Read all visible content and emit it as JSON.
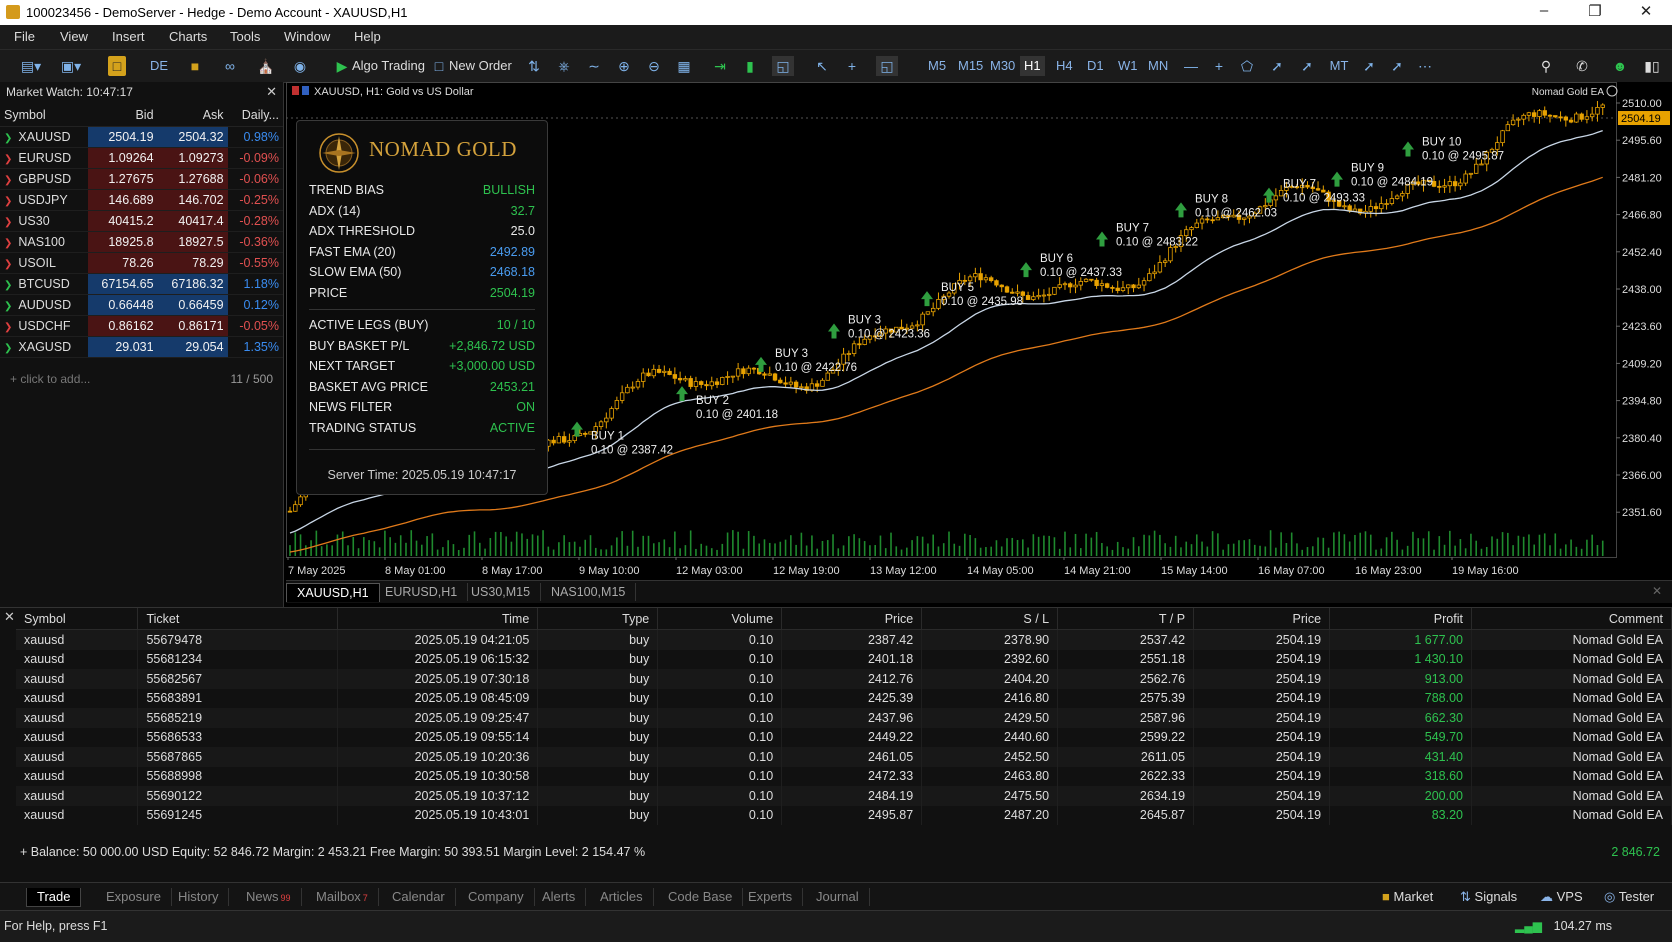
{
  "window": {
    "title": "100023456 - DemoServer - Hedge - Demo Account - XAUUSD,H1"
  },
  "menu": [
    "File",
    "View",
    "Insert",
    "Charts",
    "Tools",
    "Window",
    "Help"
  ],
  "toolbar": {
    "de": "DE",
    "algo_trading": "Algo Trading",
    "new_order": "New Order",
    "mt": "MT",
    "timeframes": [
      "M5",
      "M15",
      "M30",
      "H1",
      "H4",
      "D1",
      "W1",
      "MN"
    ],
    "active_timeframe": "H1",
    "notif_count": "1"
  },
  "market_watch": {
    "title": "Market Watch: 10:47:17",
    "columns": [
      "Symbol",
      "Bid",
      "Ask",
      "Daily..."
    ],
    "rows": [
      {
        "symbol": "XAUUSD",
        "bid": "2504.19",
        "ask": "2504.32",
        "daily": "0.98%",
        "dir": "up"
      },
      {
        "symbol": "EURUSD",
        "bid": "1.09264",
        "ask": "1.09273",
        "daily": "-0.09%",
        "dir": "dn"
      },
      {
        "symbol": "GBPUSD",
        "bid": "1.27675",
        "ask": "1.27688",
        "daily": "-0.06%",
        "dir": "dn"
      },
      {
        "symbol": "USDJPY",
        "bid": "146.689",
        "ask": "146.702",
        "daily": "-0.25%",
        "dir": "dn"
      },
      {
        "symbol": "US30",
        "bid": "40415.2",
        "ask": "40417.4",
        "daily": "-0.28%",
        "dir": "dn"
      },
      {
        "symbol": "NAS100",
        "bid": "18925.8",
        "ask": "18927.5",
        "daily": "-0.36%",
        "dir": "dn"
      },
      {
        "symbol": "USOIL",
        "bid": "78.26",
        "ask": "78.29",
        "daily": "-0.55%",
        "dir": "dn"
      },
      {
        "symbol": "BTCUSD",
        "bid": "67154.65",
        "ask": "67186.32",
        "daily": "1.18%",
        "dir": "up"
      },
      {
        "symbol": "AUDUSD",
        "bid": "0.66448",
        "ask": "0.66459",
        "daily": "0.12%",
        "dir": "up"
      },
      {
        "symbol": "USDCHF",
        "bid": "0.86162",
        "ask": "0.86171",
        "daily": "-0.05%",
        "dir": "dn"
      },
      {
        "symbol": "XAGUSD",
        "bid": "29.031",
        "ask": "29.054",
        "daily": "1.35%",
        "dir": "up"
      }
    ],
    "add_text": "+ click to add...",
    "count": "11 / 500"
  },
  "chart": {
    "header": "XAUUSD, H1: Gold vs US Dollar",
    "ea_label": "Nomad Gold EA",
    "current_price": "2504.19",
    "y_labels": [
      "2510.00",
      "2495.60",
      "2481.20",
      "2466.80",
      "2452.40",
      "2438.00",
      "2423.60",
      "2409.20",
      "2394.80",
      "2380.40",
      "2366.00",
      "2351.60"
    ],
    "x_labels": [
      "7 May 2025",
      "8 May 01:00",
      "8 May 17:00",
      "9 May 10:00",
      "12 May 03:00",
      "12 May 19:00",
      "13 May 12:00",
      "14 May 05:00",
      "14 May 21:00",
      "15 May 14:00",
      "16 May 07:00",
      "16 May 23:00",
      "19 May 16:00"
    ],
    "buy_markers": [
      {
        "label": "BUY 1",
        "detail": "0.10 @ 2387.42"
      },
      {
        "label": "BUY 2",
        "detail": "0.10 @ 2401.18"
      },
      {
        "label": "BUY 3",
        "detail": "0.10 @ 2422.76"
      },
      {
        "label": "BUY 3",
        "detail": "0.10 @ 2423.36"
      },
      {
        "label": "BUY 5",
        "detail": "0.10 @ 2435.98"
      },
      {
        "label": "BUY 6",
        "detail": "0.10 @ 2437.33"
      },
      {
        "label": "BUY 7",
        "detail": "0.10 @ 2483.22"
      },
      {
        "label": "BUY 8",
        "detail": "0.10 @ 2462.03"
      },
      {
        "label": "BUY 7",
        "detail": "0.10 @ 2493.33"
      },
      {
        "label": "BUY 9",
        "detail": "0.10 @ 2484.19"
      },
      {
        "label": "BUY 10",
        "detail": "0.10 @ 2495.87"
      }
    ],
    "tabs": [
      "XAUUSD,H1",
      "EURUSD,H1",
      "US30,M15",
      "NAS100,M15"
    ]
  },
  "panel": {
    "brand": "NOMAD GOLD",
    "rows1": [
      {
        "k": "TREND BIAS",
        "v": "BULLISH",
        "c": "#2ec24f"
      },
      {
        "k": "ADX (14)",
        "v": "32.7",
        "c": "#2ec24f"
      },
      {
        "k": "ADX THRESHOLD",
        "v": "25.0",
        "c": "#e8e8e8"
      },
      {
        "k": "FAST EMA (20)",
        "v": "2492.89",
        "c": "#4a9cf0"
      },
      {
        "k": "SLOW EMA (50)",
        "v": "2468.18",
        "c": "#4a9cf0"
      },
      {
        "k": "PRICE",
        "v": "2504.19",
        "c": "#2ec24f"
      }
    ],
    "rows2": [
      {
        "k": "ACTIVE LEGS (BUY)",
        "v": "10 / 10",
        "c": "#2ec24f"
      },
      {
        "k": "BUY BASKET P/L",
        "v": "+2,846.72 USD",
        "c": "#2ec24f"
      },
      {
        "k": "NEXT TARGET",
        "v": "+3,000.00 USD",
        "c": "#2ec24f"
      },
      {
        "k": "BASKET AVG PRICE",
        "v": "2453.21",
        "c": "#2ec24f"
      },
      {
        "k": "NEWS FILTER",
        "v": "ON",
        "c": "#2ec24f"
      },
      {
        "k": "TRADING STATUS",
        "v": "ACTIVE",
        "c": "#2ec24f"
      }
    ],
    "server_time": "Server Time: 2025.05.19 10:47:17"
  },
  "trades": {
    "columns": [
      "Symbol",
      "Ticket",
      "Time",
      "Type",
      "Volume",
      "Price",
      "S / L",
      "T / P",
      "Price",
      "Profit",
      "Comment"
    ],
    "rows": [
      [
        "xauusd",
        "55679478",
        "2025.05.19 04:21:05",
        "buy",
        "0.10",
        "2387.42",
        "2378.90",
        "2537.42",
        "2504.19",
        "1 677.00",
        "Nomad Gold EA"
      ],
      [
        "xauusd",
        "55681234",
        "2025.05.19 06:15:32",
        "buy",
        "0.10",
        "2401.18",
        "2392.60",
        "2551.18",
        "2504.19",
        "1 430.10",
        "Nomad Gold EA"
      ],
      [
        "xauusd",
        "55682567",
        "2025.05.19 07:30:18",
        "buy",
        "0.10",
        "2412.76",
        "2404.20",
        "2562.76",
        "2504.19",
        "913.00",
        "Nomad Gold EA"
      ],
      [
        "xauusd",
        "55683891",
        "2025.05.19 08:45:09",
        "buy",
        "0.10",
        "2425.39",
        "2416.80",
        "2575.39",
        "2504.19",
        "788.00",
        "Nomad Gold EA"
      ],
      [
        "xauusd",
        "55685219",
        "2025.05.19 09:25:47",
        "buy",
        "0.10",
        "2437.96",
        "2429.50",
        "2587.96",
        "2504.19",
        "662.30",
        "Nomad Gold EA"
      ],
      [
        "xauusd",
        "55686533",
        "2025.05.19 09:55:14",
        "buy",
        "0.10",
        "2449.22",
        "2440.60",
        "2599.22",
        "2504.19",
        "549.70",
        "Nomad Gold EA"
      ],
      [
        "xauusd",
        "55687865",
        "2025.05.19 10:20:36",
        "buy",
        "0.10",
        "2461.05",
        "2452.50",
        "2611.05",
        "2504.19",
        "431.40",
        "Nomad Gold EA"
      ],
      [
        "xauusd",
        "55688998",
        "2025.05.19 10:30:58",
        "buy",
        "0.10",
        "2472.33",
        "2463.80",
        "2622.33",
        "2504.19",
        "318.60",
        "Nomad Gold EA"
      ],
      [
        "xauusd",
        "55690122",
        "2025.05.19 10:37:12",
        "buy",
        "0.10",
        "2484.19",
        "2475.50",
        "2634.19",
        "2504.19",
        "200.00",
        "Nomad Gold EA"
      ],
      [
        "xauusd",
        "55691245",
        "2025.05.19 10:43:01",
        "buy",
        "0.10",
        "2495.87",
        "2487.20",
        "2645.87",
        "2504.19",
        "83.20",
        "Nomad Gold EA"
      ]
    ],
    "balance_line": "+ Balance: 50 000.00 USD   Equity: 52 846.72   Margin: 2 453.21   Free Margin: 50 393.51   Margin Level: 2 154.47 %",
    "total": "2 846.72"
  },
  "bottom_tabs": [
    {
      "label": "Trade",
      "badge": ""
    },
    {
      "label": "Exposure",
      "badge": ""
    },
    {
      "label": "History",
      "badge": ""
    },
    {
      "label": "News",
      "badge": "99"
    },
    {
      "label": "Mailbox",
      "badge": "7"
    },
    {
      "label": "Calendar",
      "badge": ""
    },
    {
      "label": "Company",
      "badge": ""
    },
    {
      "label": "Alerts",
      "badge": ""
    },
    {
      "label": "Articles",
      "badge": ""
    },
    {
      "label": "Code Base",
      "badge": ""
    },
    {
      "label": "Experts",
      "badge": ""
    },
    {
      "label": "Journal",
      "badge": ""
    }
  ],
  "right_tools": [
    "Market",
    "Signals",
    "VPS",
    "Tester"
  ],
  "status": {
    "help": "For Help, press F1",
    "ping": "104.27 ms"
  },
  "colors": {
    "bull": "#e8a200",
    "ema_fast": "#c8d6e6",
    "ema_slow": "#e07a1a",
    "buy_arrow": "#2f9e3f",
    "volume": "#1f8a2e"
  }
}
